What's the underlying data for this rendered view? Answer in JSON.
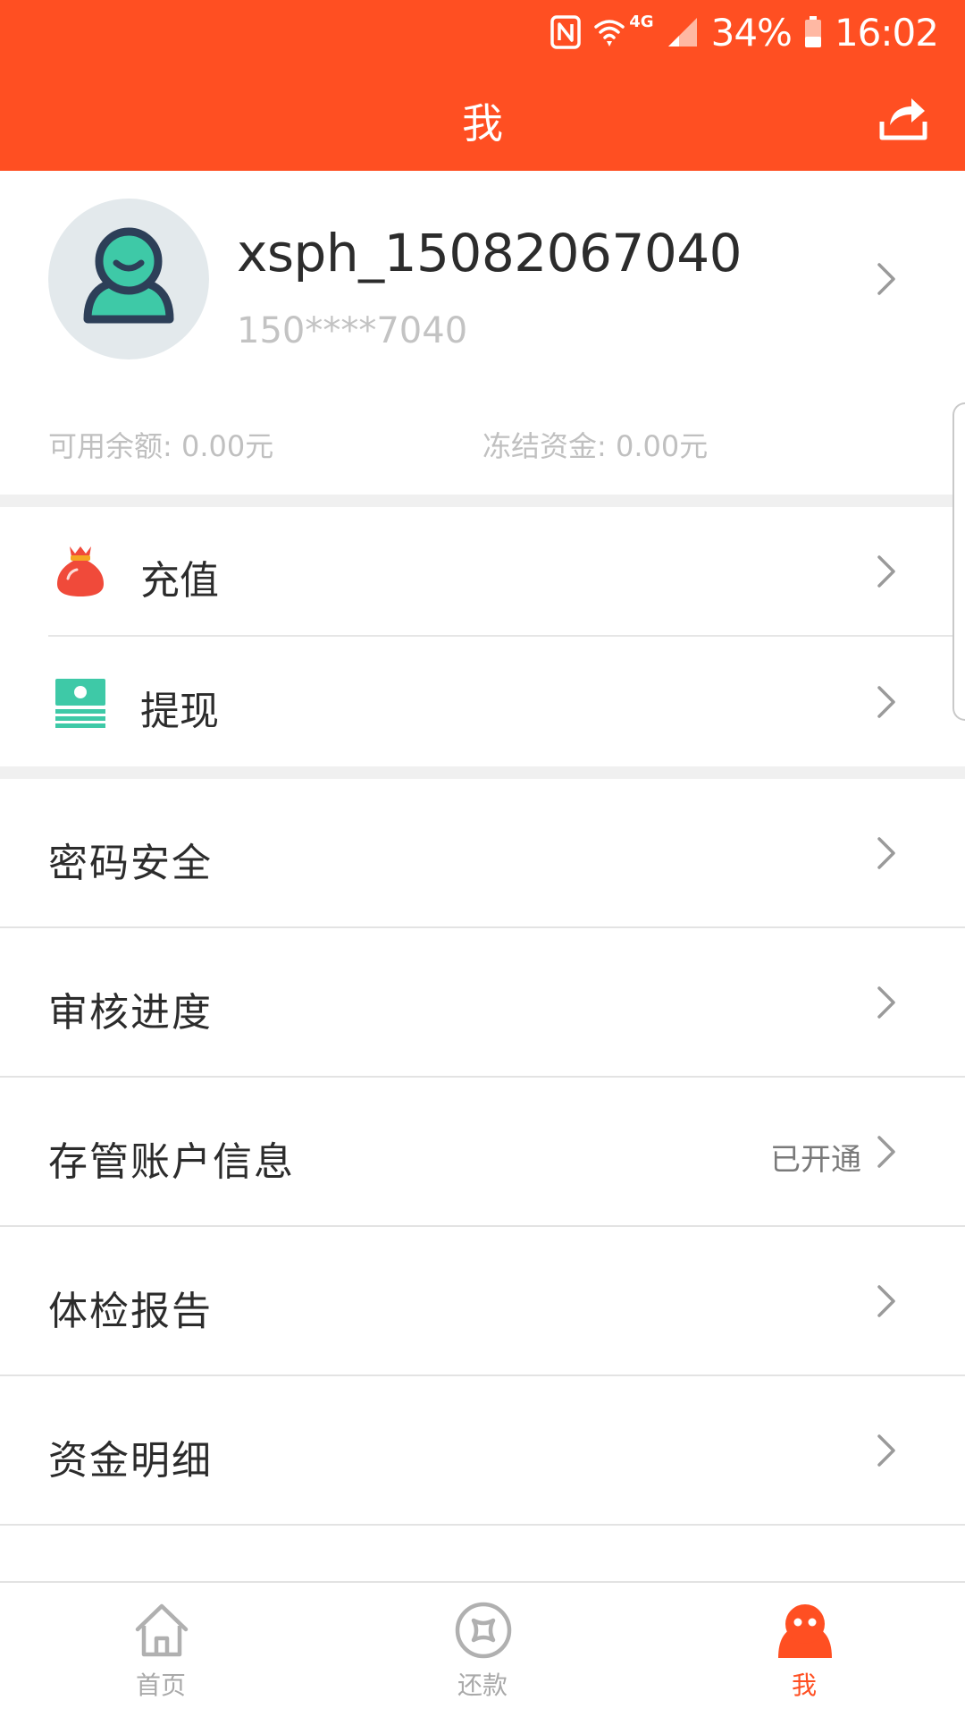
{
  "status_bar": {
    "net_type": "4G",
    "battery": "34%",
    "time": "16:02",
    "icons": [
      "nfc-icon",
      "wifi-icon",
      "signal-icon",
      "battery-icon"
    ]
  },
  "header": {
    "title": "我",
    "share_icon": "share-icon"
  },
  "profile": {
    "username": "xsph_15082067040",
    "phone": "150****7040",
    "available_balance": "可用余额: 0.00元",
    "frozen_funds": "冻结资金: 0.00元"
  },
  "money_actions": [
    {
      "label": "充值",
      "icon": "money-bag-icon"
    },
    {
      "label": "提现",
      "icon": "cash-stack-icon"
    }
  ],
  "menu": [
    {
      "label": "密码安全",
      "value": ""
    },
    {
      "label": "审核进度",
      "value": ""
    },
    {
      "label": "存管账户信息",
      "value": "已开通"
    },
    {
      "label": "体检报告",
      "value": ""
    },
    {
      "label": "资金明细",
      "value": ""
    }
  ],
  "tab_bar": {
    "tabs": [
      {
        "label": "首页",
        "icon": "home-icon"
      },
      {
        "label": "还款",
        "icon": "repay-icon"
      },
      {
        "label": "我",
        "icon": "me-icon"
      }
    ],
    "active_index": 2
  },
  "colors": {
    "brand": "#ff4f22",
    "teal": "#3ec9a7",
    "avatar_bg": "#e3e9ec"
  }
}
